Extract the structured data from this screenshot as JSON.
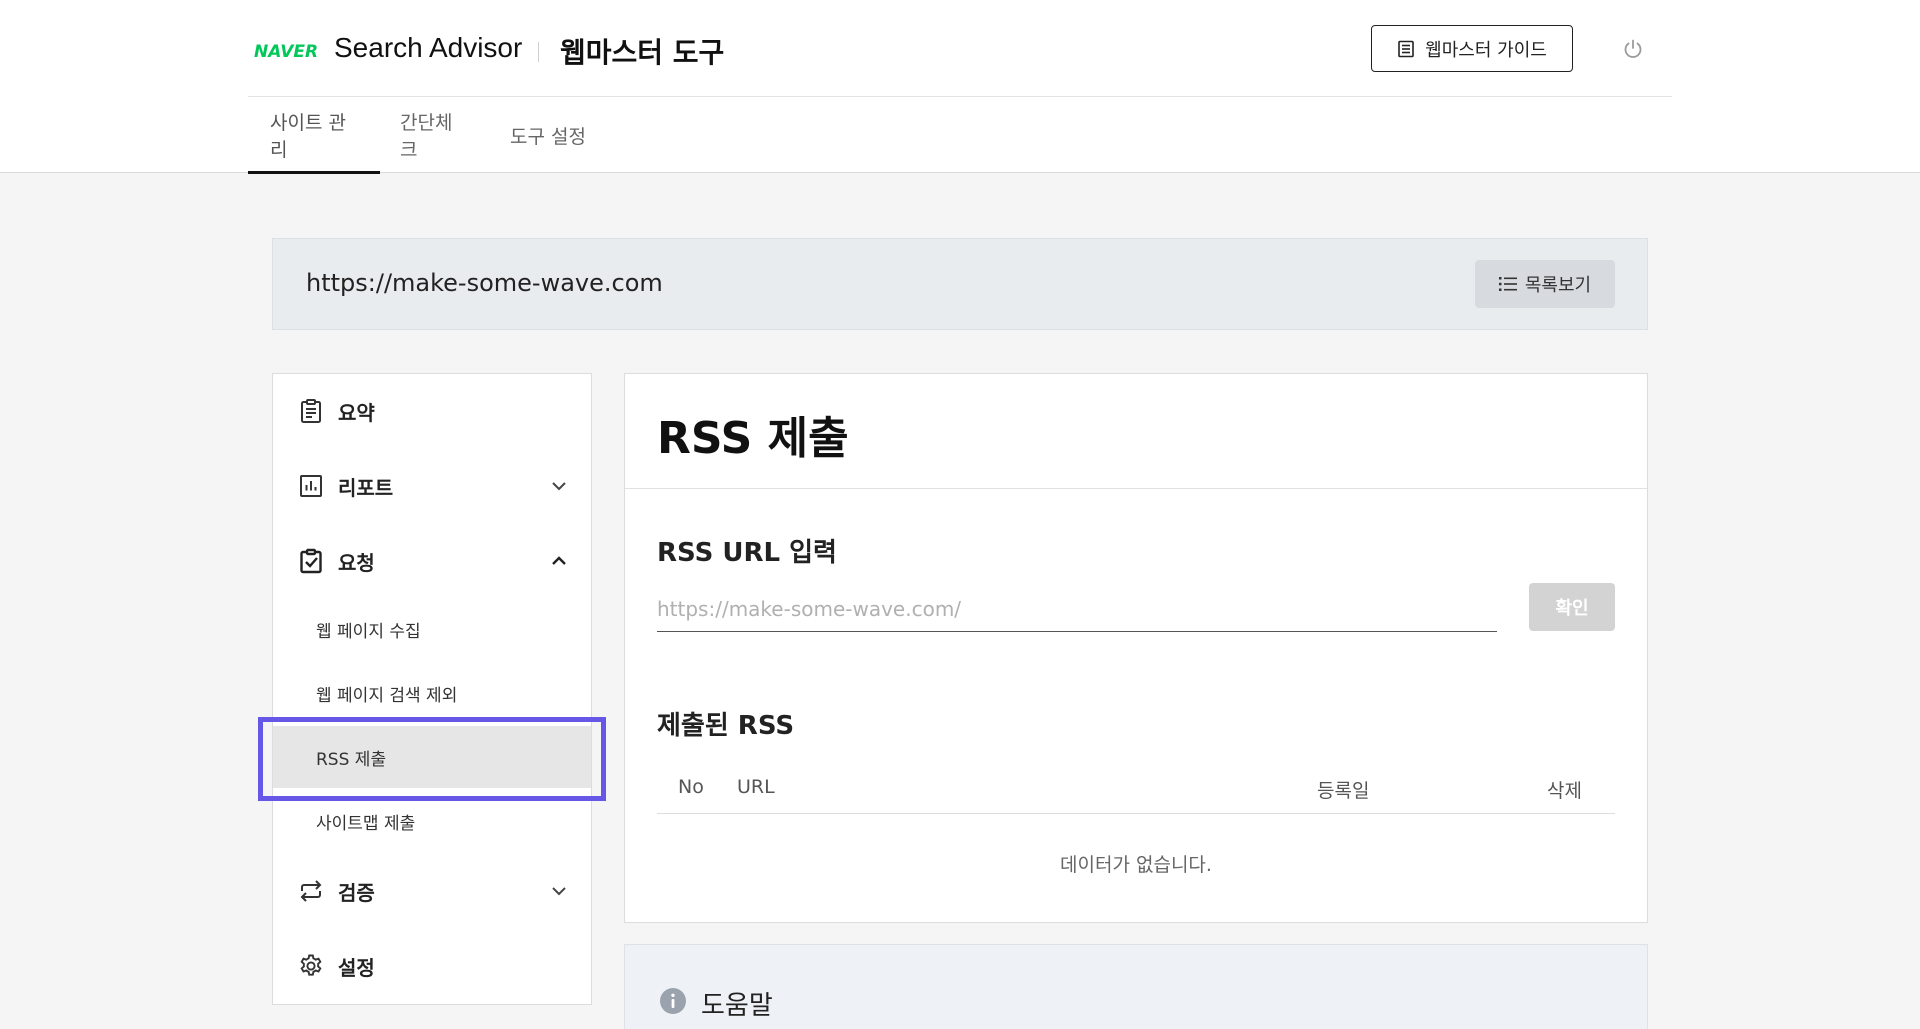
{
  "header": {
    "logo": "NAVER",
    "brand": "Search Advisor",
    "tool_title": "웹마스터 도구",
    "guide_button": "웹마스터 가이드",
    "power_icon": "power-icon"
  },
  "tabs": [
    {
      "label": "사이트 관리",
      "active": true
    },
    {
      "label": "간단체크",
      "active": false
    },
    {
      "label": "도구 설정",
      "active": false
    }
  ],
  "site_bar": {
    "url": "https://make-some-wave.com",
    "list_button": "목록보기"
  },
  "sidebar": {
    "items": [
      {
        "label": "요약",
        "icon": "clipboard-icon"
      },
      {
        "label": "리포트",
        "icon": "bar-chart-icon",
        "expanded": false
      },
      {
        "label": "요청",
        "icon": "check-clipboard-icon",
        "expanded": true
      },
      {
        "label": "검증",
        "icon": "swap-icon",
        "expanded": false
      },
      {
        "label": "설정",
        "icon": "gear-icon"
      }
    ],
    "sub_items": [
      {
        "label": "웹 페이지 수집"
      },
      {
        "label": "웹 페이지 검색 제외"
      },
      {
        "label": "RSS 제출",
        "selected": true
      },
      {
        "label": "사이트맵 제출"
      }
    ],
    "highlight_color": "#6757e6"
  },
  "main": {
    "title": "RSS 제출",
    "input_section_title": "RSS URL 입력",
    "input_placeholder": "https://make-some-wave.com/",
    "input_value": "",
    "confirm_button": "확인",
    "submitted_title": "제출된 RSS",
    "table": {
      "columns": [
        "No",
        "URL",
        "등록일",
        "삭제"
      ],
      "rows": [],
      "empty_text": "데이터가 없습니다."
    }
  },
  "help": {
    "title": "도움말",
    "icon": "info-icon"
  },
  "colors": {
    "naver_green": "#03c75a",
    "highlight": "#6757e6"
  }
}
